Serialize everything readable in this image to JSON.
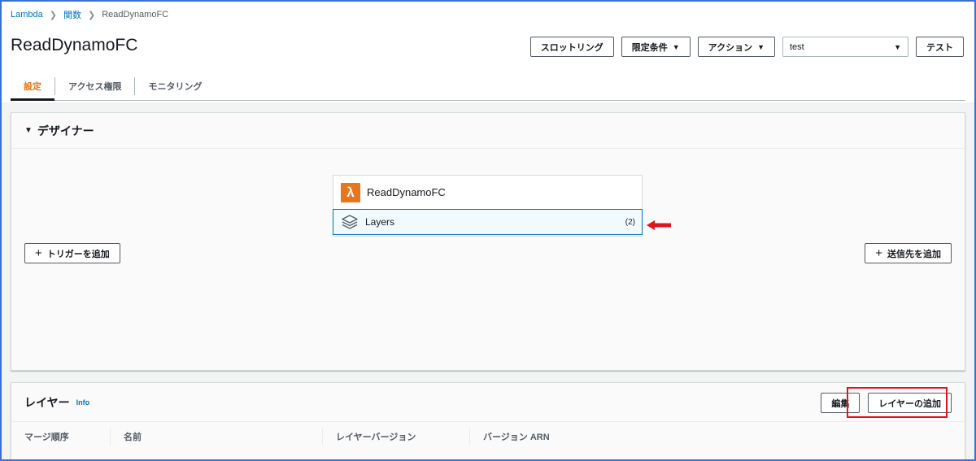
{
  "breadcrumb": {
    "items": [
      "Lambda",
      "関数"
    ],
    "current": "ReadDynamoFC"
  },
  "page": {
    "title": "ReadDynamoFC"
  },
  "header": {
    "throttle_label": "スロットリング",
    "qualifiers_label": "限定条件",
    "actions_label": "アクション",
    "test_event_value": "test",
    "test_label": "テスト"
  },
  "tabs": [
    {
      "label": "設定",
      "active": true
    },
    {
      "label": "アクセス権限",
      "active": false
    },
    {
      "label": "モニタリング",
      "active": false
    }
  ],
  "designer": {
    "title": "デザイナー",
    "function_name": "ReadDynamoFC",
    "layers_label": "Layers",
    "layers_count": "(2)",
    "add_trigger_label": "トリガーを追加",
    "add_destination_label": "送信先を追加"
  },
  "layers_panel": {
    "title": "レイヤー",
    "info_label": "Info",
    "edit_label": "編集",
    "add_layer_label": "レイヤーの追加",
    "columns": [
      "マージ順序",
      "名前",
      "レイヤーバージョン",
      "バージョン ARN"
    ]
  },
  "colors": {
    "accent_orange": "#ec7211",
    "link_blue": "#0073bb",
    "highlight_red": "#e0141e",
    "frame_blue": "#3b6fd8"
  },
  "icons": [
    "chevron-right-icon",
    "caret-down-icon",
    "lambda-icon",
    "layers-icon",
    "plus-icon",
    "red-arrow-icon"
  ]
}
